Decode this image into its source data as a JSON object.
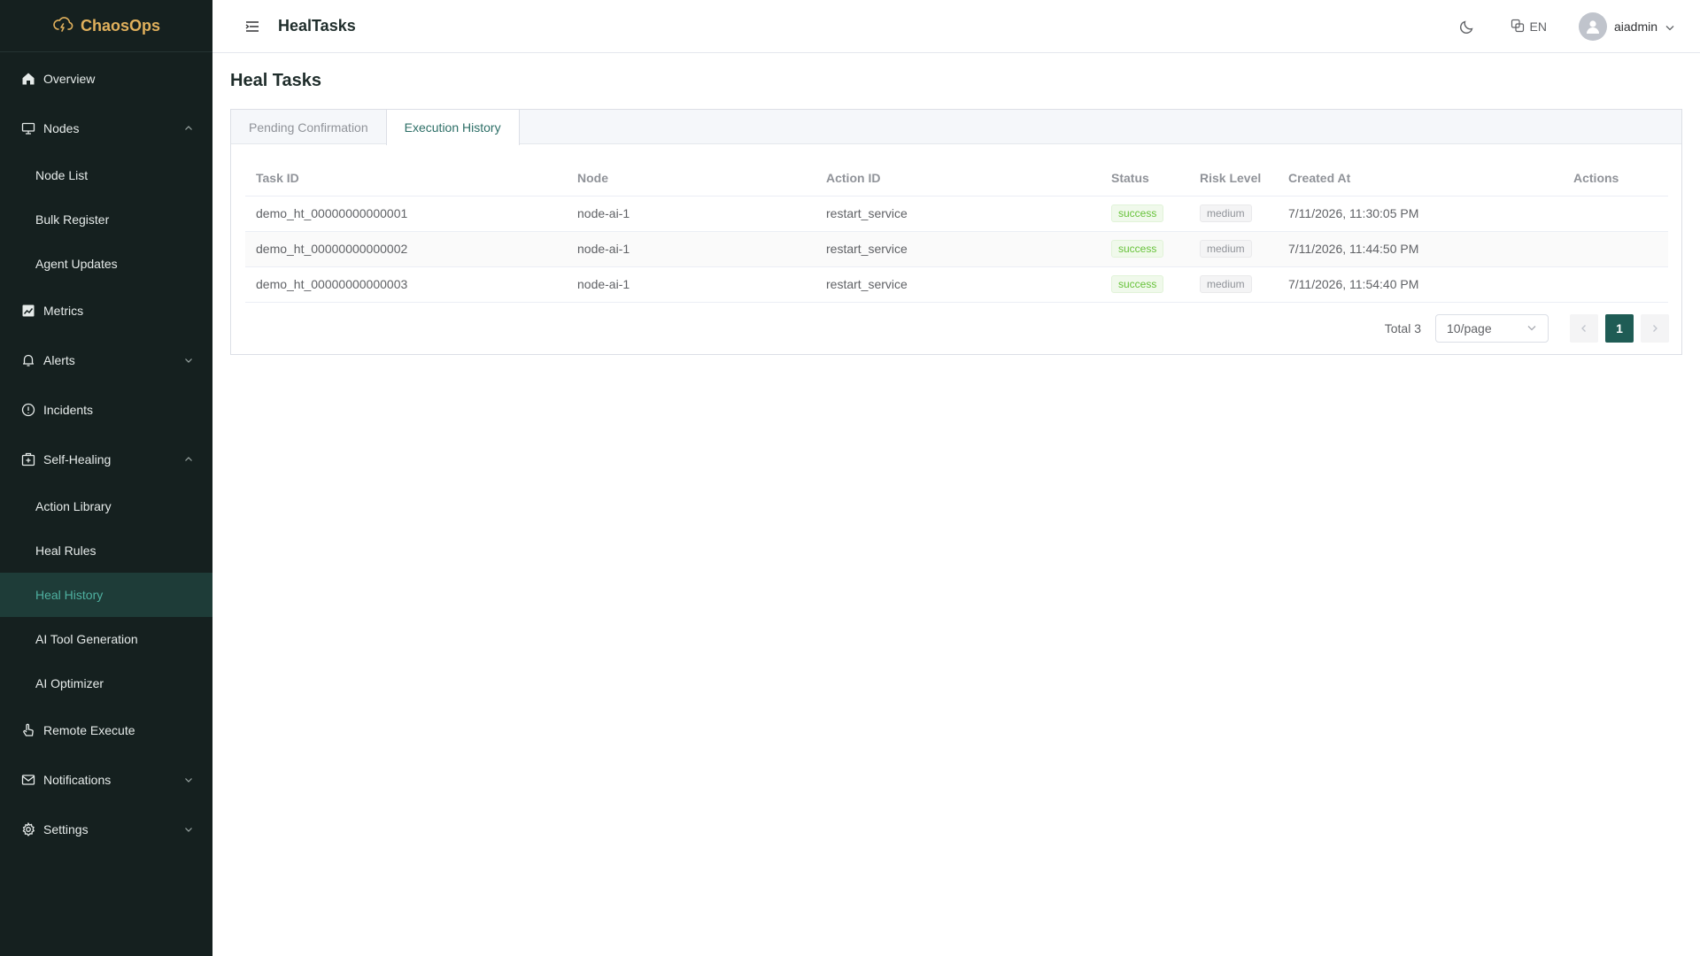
{
  "brand": {
    "name": "ChaosOps"
  },
  "sidebar": {
    "items": [
      {
        "label": "Overview",
        "icon": "home-icon"
      },
      {
        "label": "Nodes",
        "icon": "monitor-icon",
        "expanded": true
      },
      {
        "label": "Node List"
      },
      {
        "label": "Bulk Register"
      },
      {
        "label": "Agent Updates"
      },
      {
        "label": "Metrics",
        "icon": "chart-icon"
      },
      {
        "label": "Alerts",
        "icon": "bell-icon",
        "expanded": false
      },
      {
        "label": "Incidents",
        "icon": "info-circle-icon"
      },
      {
        "label": "Self-Healing",
        "icon": "medical-box-icon",
        "expanded": true
      },
      {
        "label": "Action Library"
      },
      {
        "label": "Heal Rules"
      },
      {
        "label": "Heal History",
        "active": true
      },
      {
        "label": "AI Tool Generation"
      },
      {
        "label": "AI Optimizer"
      },
      {
        "label": "Remote Execute",
        "icon": "pointer-icon"
      },
      {
        "label": "Notifications",
        "icon": "mail-icon",
        "expanded": false
      },
      {
        "label": "Settings",
        "icon": "gear-icon",
        "expanded": false
      }
    ]
  },
  "header": {
    "title": "HealTasks",
    "lang": "EN",
    "username": "aiadmin"
  },
  "main": {
    "page_title": "Heal Tasks",
    "tabs": [
      {
        "label": "Pending Confirmation",
        "active": false
      },
      {
        "label": "Execution History",
        "active": true
      }
    ],
    "table": {
      "columns": [
        "Task ID",
        "Node",
        "Action ID",
        "Status",
        "Risk Level",
        "Created At",
        "Actions"
      ],
      "rows": [
        {
          "task_id": "demo_ht_00000000000001",
          "node": "node-ai-1",
          "action_id": "restart_service",
          "status": "success",
          "risk": "medium",
          "created_at": "7/11/2026, 11:30:05 PM"
        },
        {
          "task_id": "demo_ht_00000000000002",
          "node": "node-ai-1",
          "action_id": "restart_service",
          "status": "success",
          "risk": "medium",
          "created_at": "7/11/2026, 11:44:50 PM"
        },
        {
          "task_id": "demo_ht_00000000000003",
          "node": "node-ai-1",
          "action_id": "restart_service",
          "status": "success",
          "risk": "medium",
          "created_at": "7/11/2026, 11:54:40 PM"
        }
      ]
    },
    "pagination": {
      "total_label": "Total 3",
      "page_size": "10/page",
      "current_page": "1"
    }
  },
  "colors": {
    "sidebar_bg": "#15201f",
    "brand_accent": "#e0b05c",
    "active_item_bg": "#1e3c38",
    "active_item_text": "#4fb0a0",
    "primary": "#1f5c55",
    "success": "#67c23a"
  }
}
